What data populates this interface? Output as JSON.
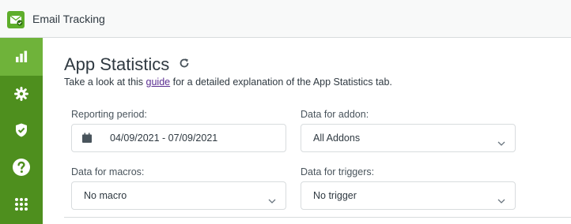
{
  "app": {
    "name": "Email Tracking",
    "logo_icon": "email-check-icon",
    "brand_color": "#5eae2b",
    "sidebar_color": "#4e8f1e",
    "sidebar_active_color": "#6fb33a"
  },
  "sidebar": {
    "items": [
      {
        "icon": "bar-chart-icon",
        "active": true
      },
      {
        "icon": "gear-icon",
        "active": false
      },
      {
        "icon": "shield-check-icon",
        "active": false
      },
      {
        "icon": "question-icon",
        "active": false
      },
      {
        "icon": "grid-dots-icon",
        "active": false
      }
    ]
  },
  "page": {
    "title": "App Statistics",
    "subtitle_before": "Take a look at this ",
    "subtitle_link": "guide",
    "subtitle_after": " for a detailed explanation of the App Statistics tab."
  },
  "filters": {
    "reporting_period": {
      "label": "Reporting period:",
      "value": "04/09/2021 - 07/09/2021"
    },
    "addon": {
      "label": "Data for addon:",
      "value": "All Addons"
    },
    "macros": {
      "label": "Data for macros:",
      "value": "No macro"
    },
    "triggers": {
      "label": "Data for triggers:",
      "value": "No trigger"
    }
  }
}
